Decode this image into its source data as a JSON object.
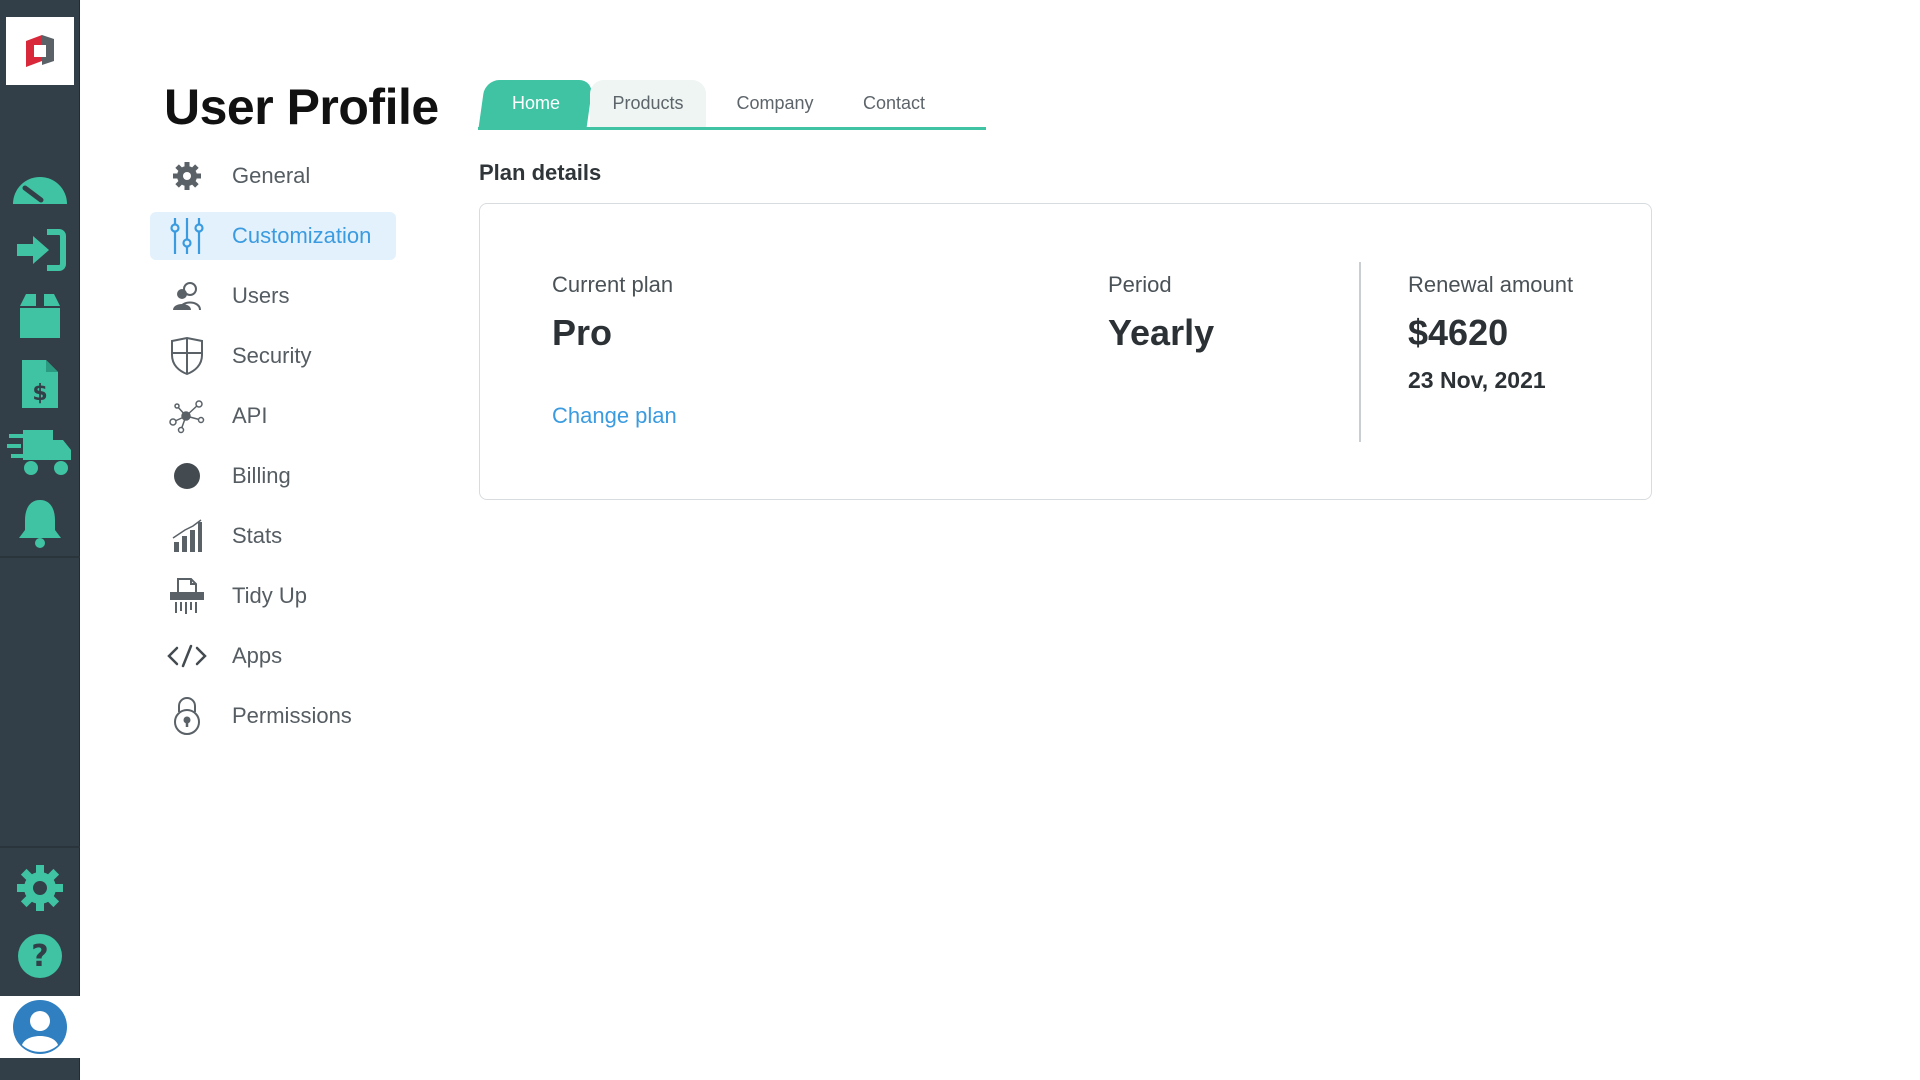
{
  "page": {
    "title": "User Profile"
  },
  "rail": {
    "items": [
      {
        "name": "dashboard-icon"
      },
      {
        "name": "login-icon"
      },
      {
        "name": "package-icon"
      },
      {
        "name": "invoice-icon"
      },
      {
        "name": "delivery-truck-icon"
      },
      {
        "name": "bell-icon"
      }
    ],
    "bottom": [
      {
        "name": "gear-icon"
      },
      {
        "name": "help-icon"
      },
      {
        "name": "avatar-icon"
      }
    ]
  },
  "nav": {
    "items": [
      {
        "label": "General",
        "icon": "gear-icon",
        "active": false
      },
      {
        "label": "Customization",
        "icon": "sliders-icon",
        "active": true
      },
      {
        "label": "Users",
        "icon": "users-icon",
        "active": false
      },
      {
        "label": "Security",
        "icon": "shield-icon",
        "active": false
      },
      {
        "label": "API",
        "icon": "network-icon",
        "active": false
      },
      {
        "label": "Billing",
        "icon": "circle-icon",
        "active": false
      },
      {
        "label": "Stats",
        "icon": "bar-chart-icon",
        "active": false
      },
      {
        "label": "Tidy Up",
        "icon": "shredder-icon",
        "active": false
      },
      {
        "label": "Apps",
        "icon": "code-icon",
        "active": false
      },
      {
        "label": "Permissions",
        "icon": "lock-icon",
        "active": false
      }
    ]
  },
  "tabs": [
    {
      "label": "Home",
      "active": true
    },
    {
      "label": "Products",
      "active": false
    },
    {
      "label": "Company",
      "active": false
    },
    {
      "label": "Contact",
      "active": false
    }
  ],
  "plan": {
    "heading": "Plan details",
    "current_plan_label": "Current plan",
    "current_plan_value": "Pro",
    "change_plan_link": "Change plan",
    "period_label": "Period",
    "period_value": "Yearly",
    "renewal_label": "Renewal amount",
    "renewal_value": "$4620",
    "renewal_date": "23 Nov, 2021"
  },
  "colors": {
    "rail_bg": "#333f48",
    "rail_icon": "#3fc3a3",
    "accent": "#3fc3a3",
    "link": "#3a9be0",
    "active_nav_bg": "#e3f1fc"
  }
}
